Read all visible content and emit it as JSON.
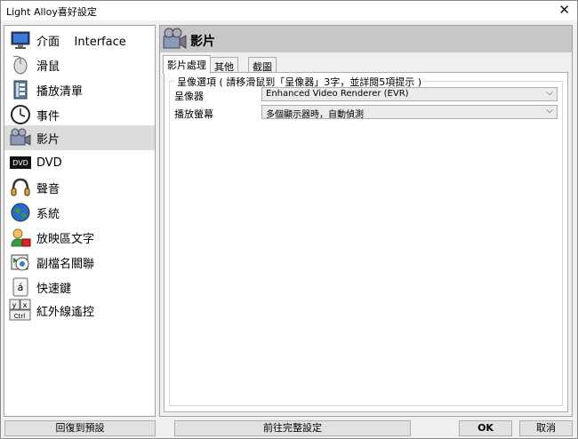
{
  "window": {
    "title": "Light Alloy喜好設定",
    "close_glyph": "✕"
  },
  "sidebar": {
    "items": [
      {
        "label": "介面    Interface",
        "icon": "monitor-icon"
      },
      {
        "label": "滑鼠",
        "icon": "mouse-icon"
      },
      {
        "label": "播放清單",
        "icon": "playlist-icon"
      },
      {
        "label": "事件",
        "icon": "clock-icon"
      },
      {
        "label": "影片",
        "icon": "camera-icon",
        "selected": true
      },
      {
        "label": "DVD",
        "icon": "dvd-icon"
      },
      {
        "label": "聲音",
        "icon": "headphones-icon"
      },
      {
        "label": "系統",
        "icon": "globe-icon"
      },
      {
        "label": "放映區文字",
        "icon": "user-text-icon"
      },
      {
        "label": "副檔名關聯",
        "icon": "file-association-icon"
      },
      {
        "label": "快速鍵",
        "icon": "hotkey-icon"
      },
      {
        "label": "紅外線遙控",
        "icon": "remote-icon"
      }
    ]
  },
  "panel": {
    "title": "影片",
    "tabs": [
      {
        "label": "影片處理",
        "active": true
      },
      {
        "label": "其他"
      },
      {
        "label": "截圖"
      }
    ],
    "group_label": "呈像選項 ( 請移滑鼠到「呈像器」3字，並詳閱5項提示 )",
    "renderer_label": "呈像器",
    "renderer_value": "Enhanced Video Renderer (EVR)",
    "screen_label": "播放螢幕",
    "screen_value": "多個顯示器時，自動偵測",
    "dropdown_glyph": "⌵"
  },
  "footer": {
    "reset_label": "回復到預設",
    "full_settings_label": "前往完整設定",
    "ok_label": "OK",
    "cancel_label": "取消"
  }
}
